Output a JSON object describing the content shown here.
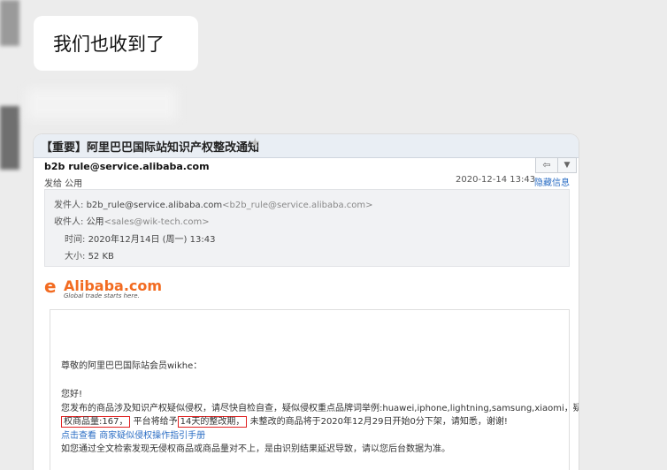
{
  "chat": {
    "message": "我们也收到了"
  },
  "email": {
    "subject": "【重要】阿里巴巴国际站知识产权整改通知",
    "sender_line": "b2b rule@service.alibaba.com",
    "to_line": "发给 公用",
    "date": "2020-12-14 13:43",
    "hide_info_label": "隐藏信息",
    "reply_icon": "reply-icon",
    "more_icon": "chevron-down-icon",
    "details": {
      "from_label": "发件人:",
      "from_name": "b2b_rule@service.alibaba.com",
      "from_addr": "<b2b_rule@service.alibaba.com>",
      "to_label": "收件人:",
      "to_name": "公用",
      "to_addr": "<sales@wik-tech.com>",
      "time_label": "时间:",
      "time_value": "2020年12月14日 (周一) 13:43",
      "size_label": "大小:",
      "size_value": "52 KB"
    },
    "logo": {
      "mark": "e",
      "name": "Alibaba.com",
      "tagline": "Global trade starts here."
    },
    "body": {
      "greeting": "尊敬的阿里巴巴国际站会员wikhe：",
      "hello": "您好!",
      "line1": "您发布的商品涉及知识产权疑似侵权，请尽快自检自查，疑似侵权重点品牌词举例:huawei,iphone,lightning,samsung,xiaomi，疑似侵",
      "line2_hl1": "权商品量:167，",
      "line2_mid": "平台将给予",
      "line2_hl2": "14天的整改期，",
      "line2_end": "未整改的商品将于2020年12月29日开始0分下架，请知悉，谢谢!",
      "link_view": "点击查看",
      "link_manual": "商家疑似侵权操作指引手册",
      "line4": "如您通过全文检索发现无侵权商品或商品量对不上，是由识别结果延迟导致，请以您后台数据为准。"
    }
  }
}
